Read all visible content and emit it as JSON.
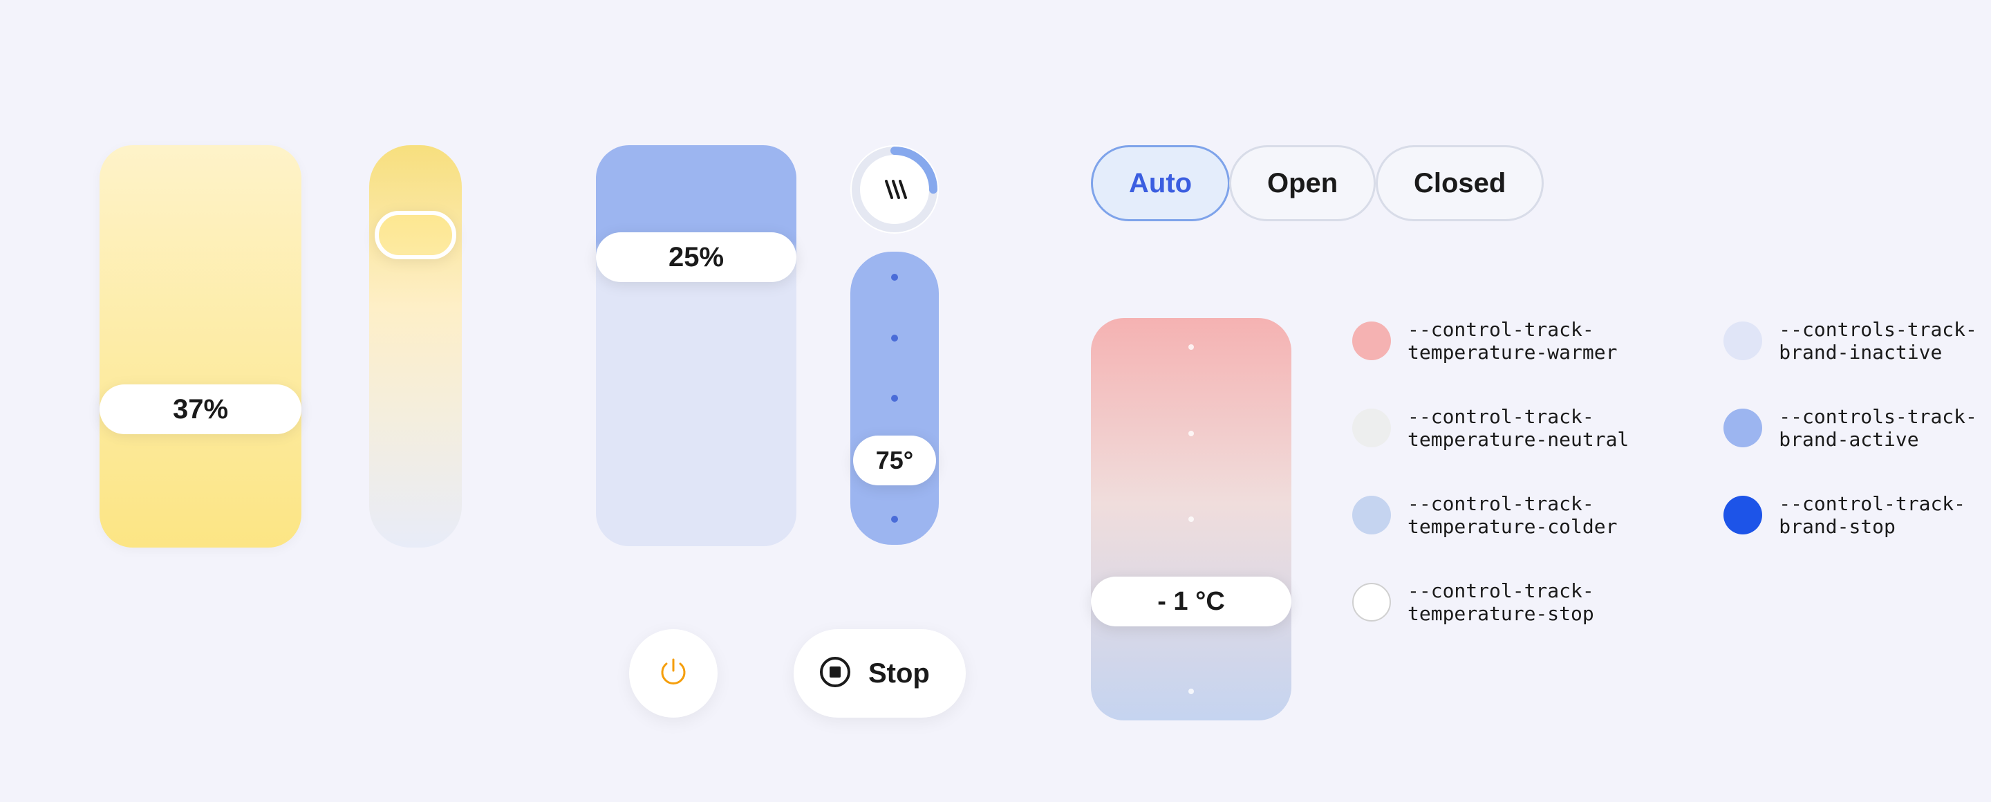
{
  "yellowLarge": {
    "value": "37%"
  },
  "blueSlider": {
    "value": "25%"
  },
  "tempBlue": {
    "value": "75°"
  },
  "tempGradient": {
    "value": "- 1 °C"
  },
  "buttons": {
    "stop": "Stop"
  },
  "segments": {
    "auto": "Auto",
    "open": "Open",
    "closed": "Closed"
  },
  "legend": {
    "warmer": "--control-track-temperature-warmer",
    "neutral": "--control-track-temperature-neutral",
    "colder": "--control-track-temperature-colder",
    "tempStop": "--control-track-temperature-stop",
    "inactive": "--controls-track-brand-inactive",
    "active": "--controls-track-brand-active",
    "brandStop": "--control-track-brand-stop"
  },
  "colors": {
    "warmer": "#f5b2b2",
    "neutral": "#edeeee",
    "colder": "#c5d4f0",
    "tempStop": "#ffffff",
    "inactive": "#e0e5f7",
    "active": "#9cb5f0",
    "brandStop": "#1d54e8",
    "accentAmber": "#f59e0b",
    "accentBlue": "#3b5ee0"
  }
}
